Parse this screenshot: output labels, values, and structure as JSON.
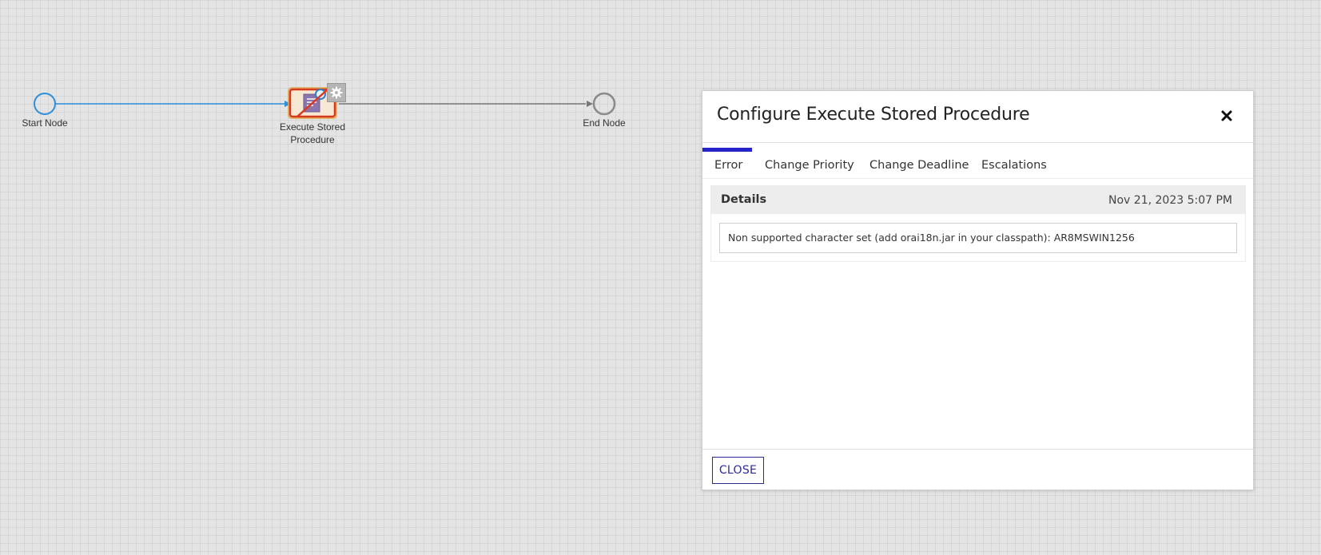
{
  "workflow": {
    "start_node": {
      "label": "Start Node"
    },
    "task_node": {
      "label_line1": "Execute Stored",
      "label_line2": "Procedure",
      "status": "error",
      "error_color": "#d9391f"
    },
    "end_node": {
      "label": "End Node"
    },
    "colors": {
      "active_connector": "#2f8fd8",
      "inactive_connector": "#777777"
    }
  },
  "dialog": {
    "title": "Configure Execute Stored Procedure",
    "tabs": [
      {
        "label": "Error",
        "active": true
      },
      {
        "label": "Change Priority",
        "active": false
      },
      {
        "label": "Change Deadline",
        "active": false
      },
      {
        "label": "Escalations",
        "active": false
      }
    ],
    "details": {
      "title": "Details",
      "timestamp": "Nov 21, 2023 5:07 PM",
      "error_message": "Non supported character set (add orai18n.jar in your classpath): AR8MSWIN1256"
    },
    "footer": {
      "close_label": "CLOSE"
    },
    "accent_color": "#2424c8"
  }
}
